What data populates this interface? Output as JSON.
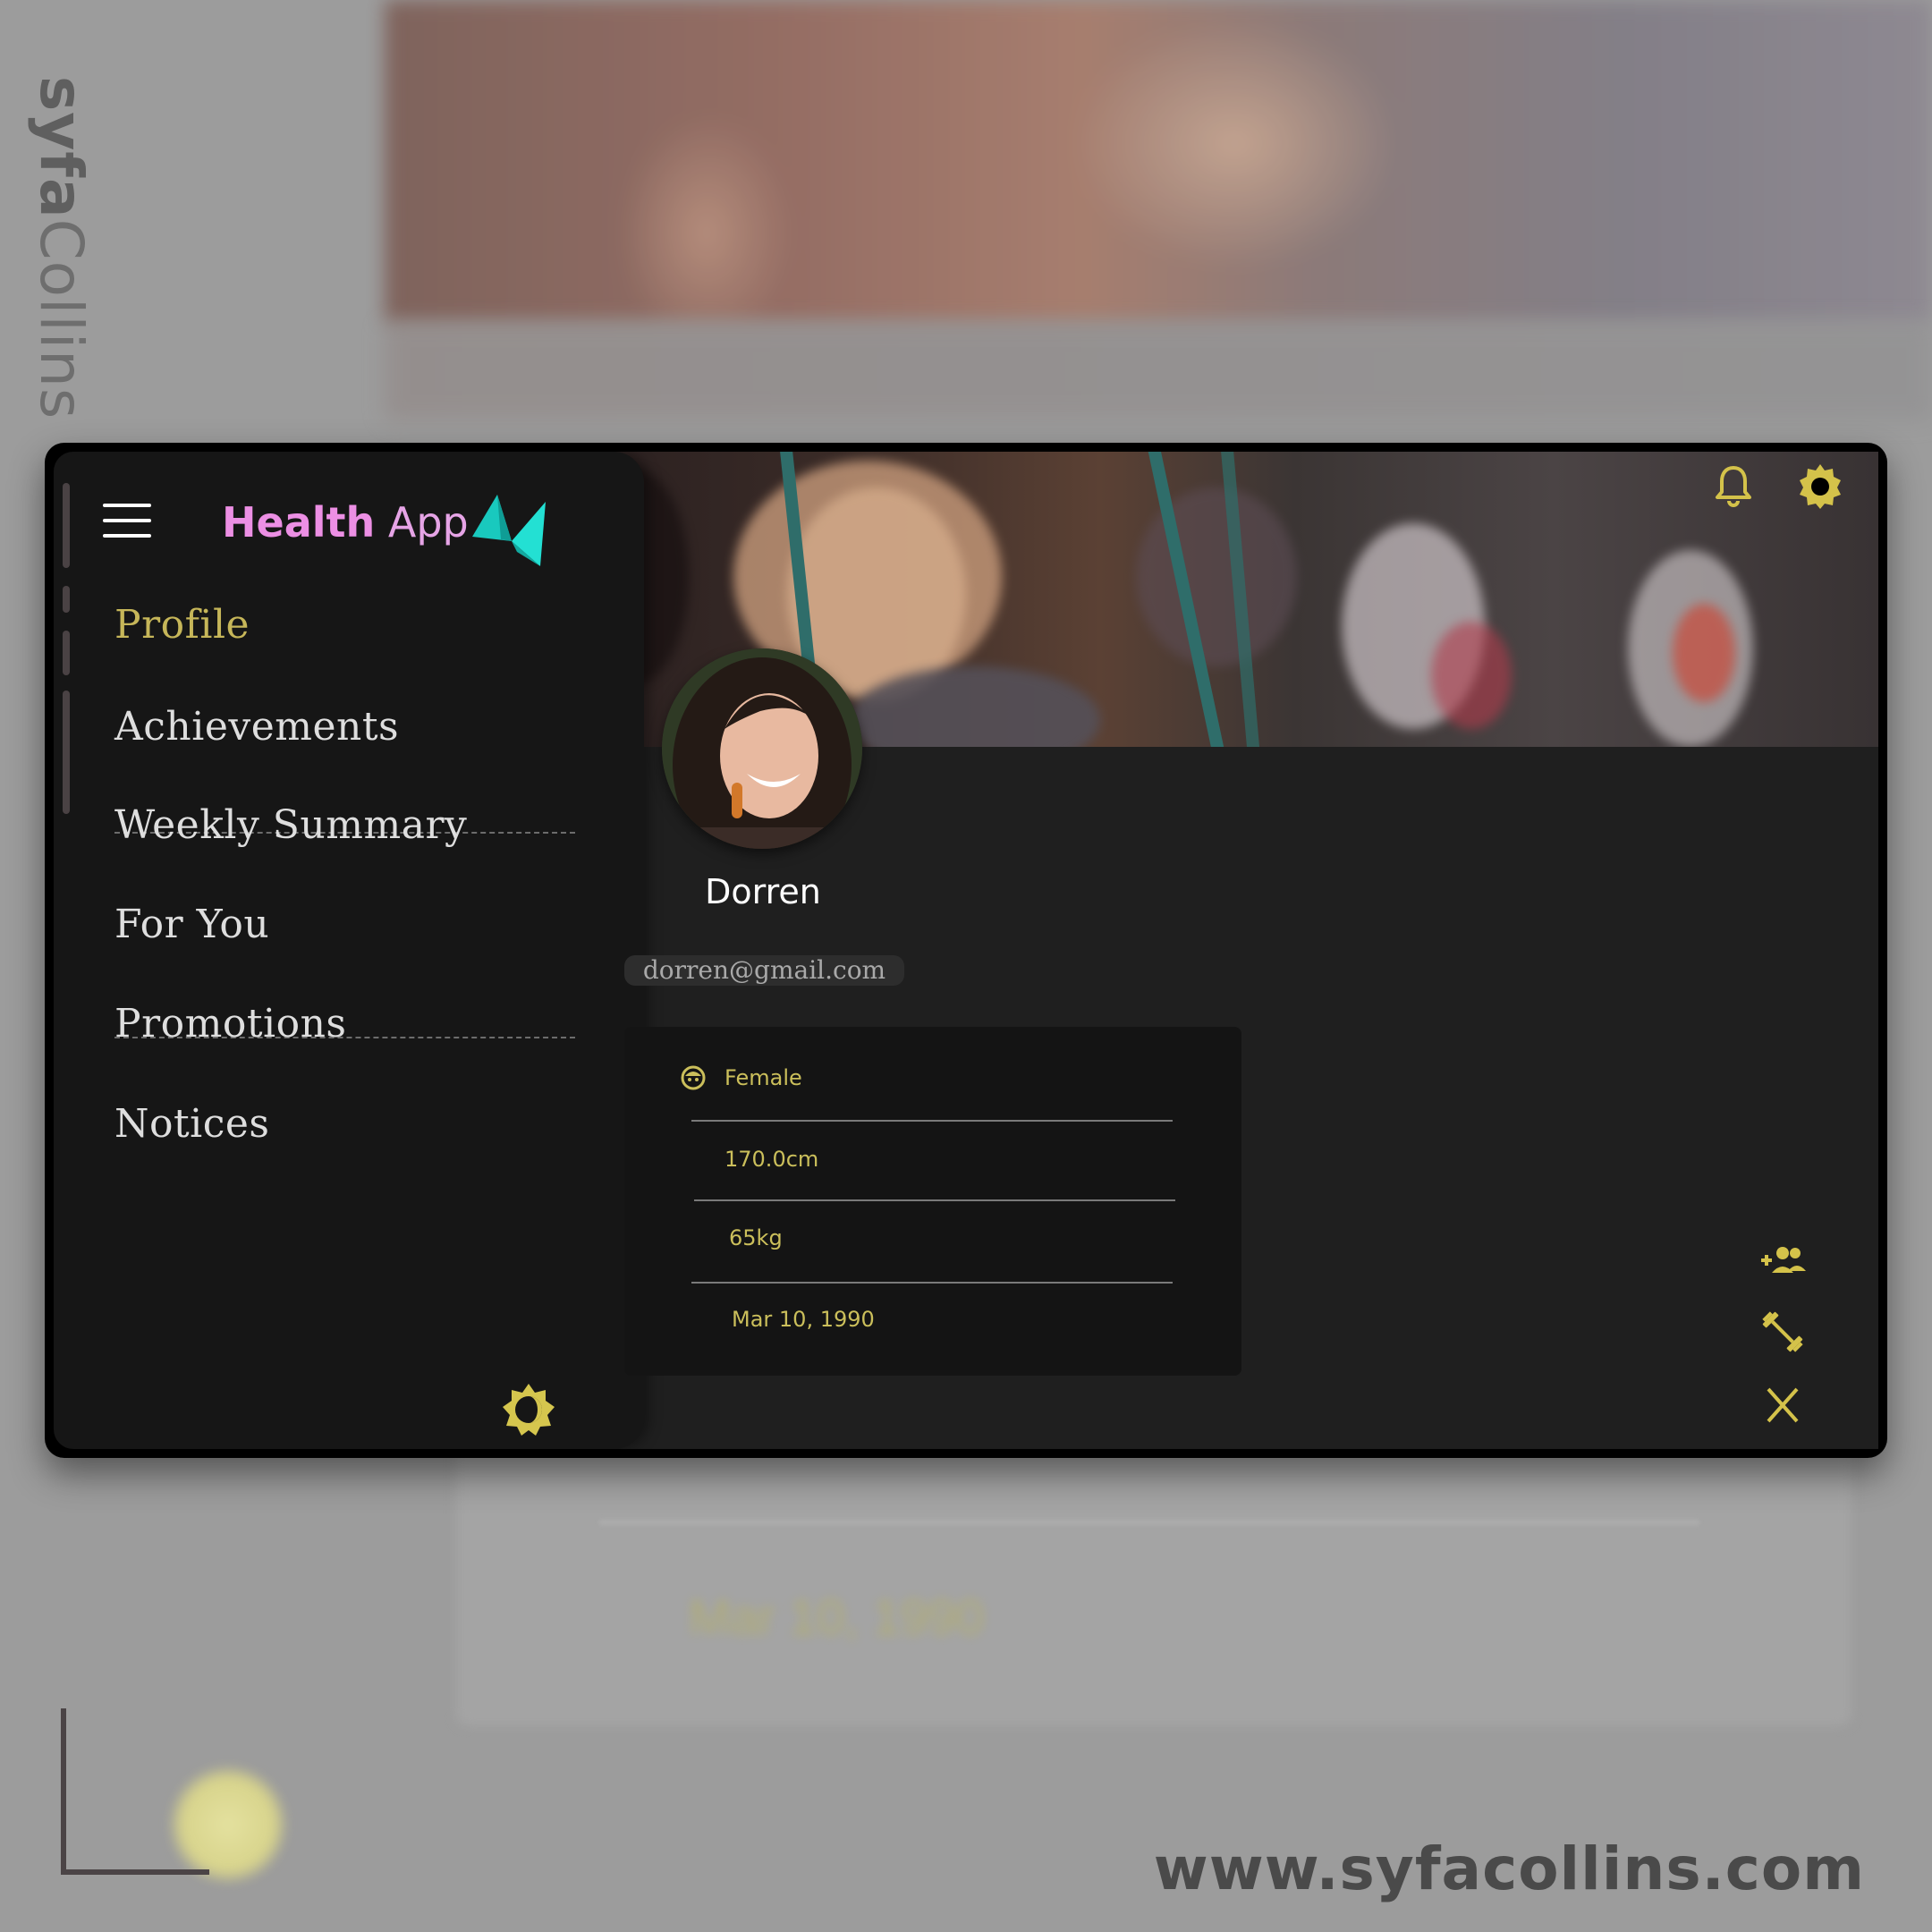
{
  "branding": {
    "side_brand_bold": "syfa",
    "side_brand_rest": "Collins",
    "website": "www.syfacollins.com"
  },
  "background": {
    "blurred_date": "Mar 10, 1990"
  },
  "app": {
    "title_bold": "Health",
    "title_rest": " App",
    "logo_icon": "origami-bird-logo",
    "accent_color": "#c6b659",
    "title_color": "#ec8fe4",
    "logo_color": "#1fd3c8"
  },
  "header": {
    "menu_icon": "hamburger-menu-icon",
    "notifications_icon": "bell-icon",
    "settings_icon": "gear-icon"
  },
  "sidebar": {
    "items": [
      {
        "label": "Profile",
        "active": true
      },
      {
        "label": "Achievements",
        "active": false
      },
      {
        "label": "Weekly Summary",
        "active": false
      },
      {
        "label": "For You",
        "active": false
      },
      {
        "label": "Promotions",
        "active": false
      },
      {
        "label": "Notices",
        "active": false
      }
    ],
    "theme_toggle_icon": "sun-moon-icon"
  },
  "profile": {
    "name": "Dorren",
    "email": "dorren@gmail.com",
    "details": {
      "gender": "Female",
      "gender_icon": "face-icon",
      "height": "170.0cm",
      "weight": "65kg",
      "birthdate": "Mar 10, 1990"
    }
  },
  "actions": {
    "add_friend_icon": "add-group-icon",
    "fitness_icon": "dumbbell-icon",
    "close_icon": "close-icon"
  }
}
